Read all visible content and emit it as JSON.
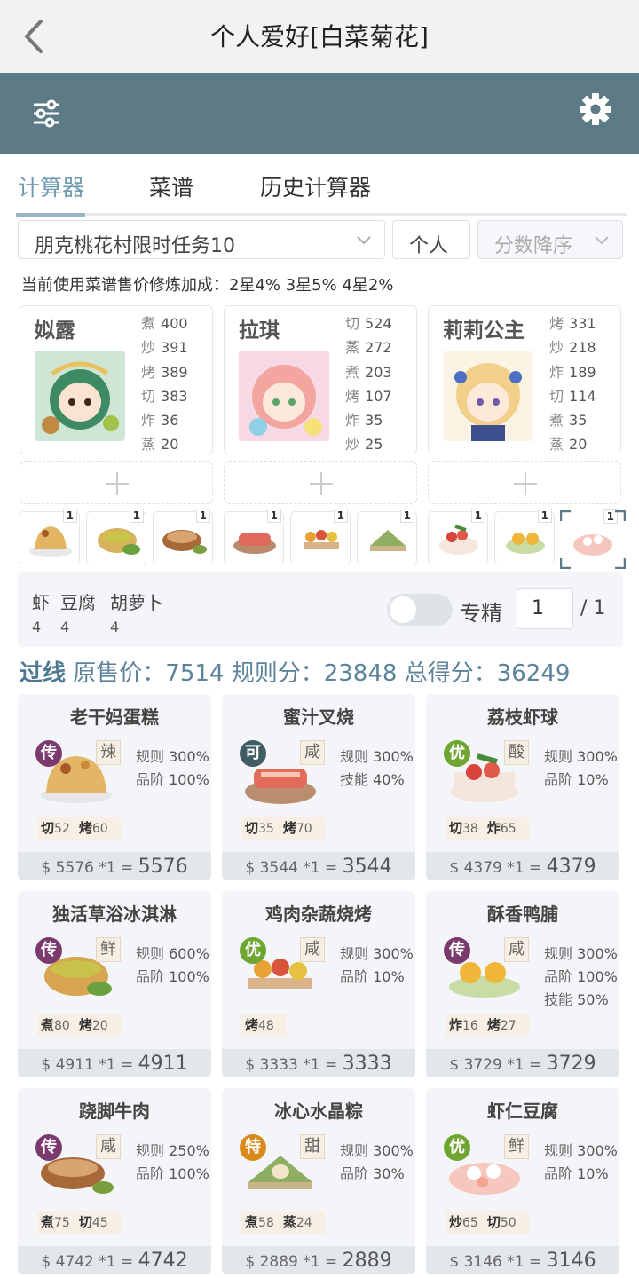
{
  "header": {
    "title": "个人爱好[白菜菊花]"
  },
  "tabs": [
    {
      "label": "计算器"
    },
    {
      "label": "菜谱"
    },
    {
      "label": "历史计算器"
    }
  ],
  "filters": {
    "task": "朋克桃花村限时任务10",
    "scope": "个人",
    "sort": "分数降序"
  },
  "bonus_text": "当前使用菜谱售价修炼加成：2星4% 3星5% 4星2%",
  "chefs": [
    {
      "name": "姒露",
      "skills": [
        [
          "煮",
          "400"
        ],
        [
          "炒",
          "391"
        ],
        [
          "烤",
          "389"
        ],
        [
          "切",
          "383"
        ],
        [
          "炸",
          "36"
        ],
        [
          "蒸",
          "20"
        ]
      ]
    },
    {
      "name": "拉琪",
      "skills": [
        [
          "切",
          "524"
        ],
        [
          "蒸",
          "272"
        ],
        [
          "煮",
          "203"
        ],
        [
          "烤",
          "107"
        ],
        [
          "炸",
          "35"
        ],
        [
          "炒",
          "25"
        ]
      ]
    },
    {
      "name": "莉莉公主",
      "skills": [
        [
          "烤",
          "331"
        ],
        [
          "炒",
          "218"
        ],
        [
          "炸",
          "189"
        ],
        [
          "切",
          "114"
        ],
        [
          "煮",
          "35"
        ],
        [
          "蒸",
          "20"
        ]
      ]
    }
  ],
  "dish_slots": [
    "1",
    "1",
    "1",
    "1",
    "1",
    "1",
    "1",
    "1",
    "1"
  ],
  "materials": [
    {
      "name": "虾",
      "count": "4"
    },
    {
      "name": "豆腐",
      "count": "4"
    },
    {
      "name": "胡萝卜",
      "count": "4"
    }
  ],
  "specialize": {
    "label": "专精",
    "value": "1",
    "total": "/ 1"
  },
  "score": {
    "pass": "过线",
    "text": "原售价：7514 规则分：23848 总得分：36249"
  },
  "results": [
    {
      "name": "老干妈蛋糕",
      "rank": "传",
      "taste": "辣",
      "bonus": [
        [
          "规则",
          "300%"
        ],
        [
          "品阶",
          "100%"
        ]
      ],
      "skills": [
        [
          "切",
          "52"
        ],
        [
          "烤",
          "60"
        ]
      ],
      "formula": "5576 *1 =",
      "total": "5576"
    },
    {
      "name": "蜜汁叉烧",
      "rank": "可",
      "taste": "咸",
      "bonus": [
        [
          "规则",
          "300%"
        ],
        [
          "技能",
          "40%"
        ]
      ],
      "skills": [
        [
          "切",
          "35"
        ],
        [
          "烤",
          "70"
        ]
      ],
      "formula": "3544 *1 =",
      "total": "3544"
    },
    {
      "name": "荔枝虾球",
      "rank": "优",
      "taste": "酸",
      "bonus": [
        [
          "规则",
          "300%"
        ],
        [
          "品阶",
          "10%"
        ]
      ],
      "skills": [
        [
          "切",
          "38"
        ],
        [
          "炸",
          "65"
        ]
      ],
      "formula": "4379 *1 =",
      "total": "4379"
    },
    {
      "name": "独活草浴冰淇淋",
      "rank": "传",
      "taste": "鲜",
      "bonus": [
        [
          "规则",
          "600%"
        ],
        [
          "品阶",
          "100%"
        ]
      ],
      "skills": [
        [
          "煮",
          "80"
        ],
        [
          "烤",
          "20"
        ]
      ],
      "formula": "4911 *1 =",
      "total": "4911"
    },
    {
      "name": "鸡肉杂蔬烧烤",
      "rank": "优",
      "taste": "咸",
      "bonus": [
        [
          "规则",
          "300%"
        ],
        [
          "品阶",
          "10%"
        ]
      ],
      "skills": [
        [
          "烤",
          "48"
        ]
      ],
      "formula": "3333 *1 =",
      "total": "3333"
    },
    {
      "name": "酥香鸭脯",
      "rank": "传",
      "taste": "咸",
      "bonus": [
        [
          "规则",
          "300%"
        ],
        [
          "品阶",
          "100%"
        ],
        [
          "技能",
          "50%"
        ]
      ],
      "skills": [
        [
          "炸",
          "16"
        ],
        [
          "烤",
          "27"
        ]
      ],
      "formula": "3729 *1 =",
      "total": "3729"
    },
    {
      "name": "跷脚牛肉",
      "rank": "传",
      "taste": "咸",
      "bonus": [
        [
          "规则",
          "250%"
        ],
        [
          "品阶",
          "100%"
        ]
      ],
      "skills": [
        [
          "煮",
          "75"
        ],
        [
          "切",
          "45"
        ]
      ],
      "formula": "4742 *1 =",
      "total": "4742"
    },
    {
      "name": "冰心水晶粽",
      "rank": "特",
      "taste": "甜",
      "bonus": [
        [
          "规则",
          "300%"
        ],
        [
          "品阶",
          "30%"
        ]
      ],
      "skills": [
        [
          "煮",
          "58"
        ],
        [
          "蒸",
          "24"
        ]
      ],
      "formula": "2889 *1 =",
      "total": "2889"
    },
    {
      "name": "虾仁豆腐",
      "rank": "优",
      "taste": "鲜",
      "bonus": [
        [
          "规则",
          "300%"
        ],
        [
          "品阶",
          "10%"
        ]
      ],
      "skills": [
        [
          "炒",
          "65"
        ],
        [
          "切",
          "50"
        ]
      ],
      "formula": "3146 *1 =",
      "total": "3146"
    }
  ],
  "rank_colors": {
    "传": "#7b3a6e",
    "可": "#3f5d63",
    "优": "#6fa531",
    "特": "#d98a1a"
  },
  "accent": "#5d7b87"
}
